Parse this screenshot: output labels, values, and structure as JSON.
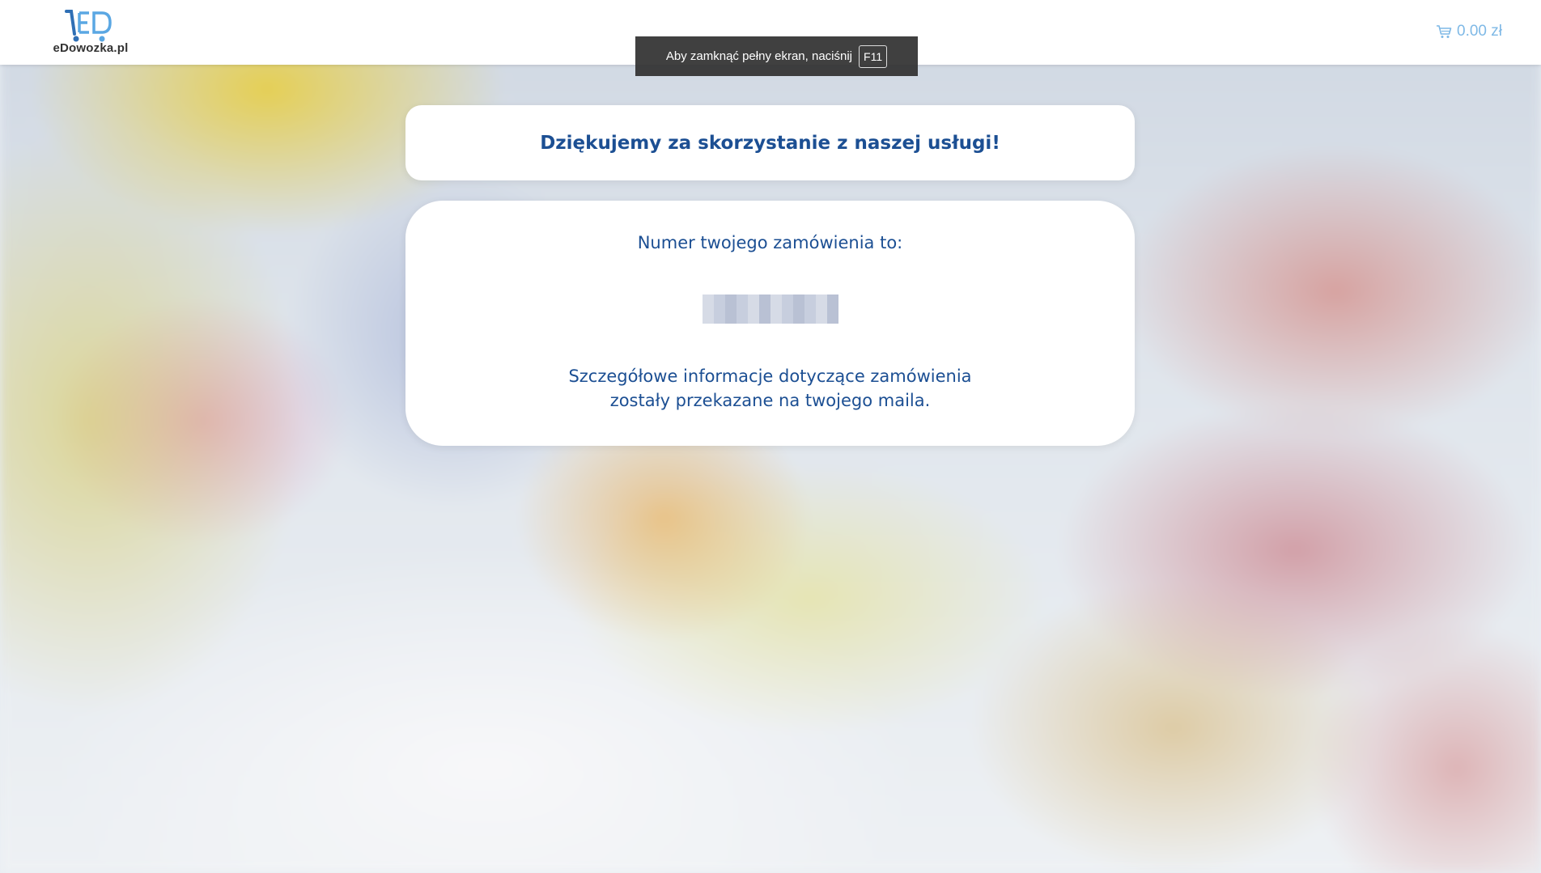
{
  "header": {
    "logo_text": "eDowozka.pl",
    "cart": {
      "icon": "cart-icon",
      "total": "0.00 zł"
    }
  },
  "fullscreen_notice": {
    "text": "Aby zamknąć pełny ekran, naciśnij",
    "key": "F11"
  },
  "thanks_card": {
    "title": "Dziękujemy za skorzystanie z naszej usługi!"
  },
  "order_card": {
    "label": "Numer twojego zamówienia to:",
    "info_line_1": "Szczegółowe informacje dotyczące zamówienia",
    "info_line_2": "zostały przekazane na twojego maila."
  },
  "colors": {
    "brand_blue": "#1c4f93",
    "cart_blue": "#7fb9e6",
    "logo_blue": "#3a8fd6",
    "header_bg": "#ffffff"
  }
}
